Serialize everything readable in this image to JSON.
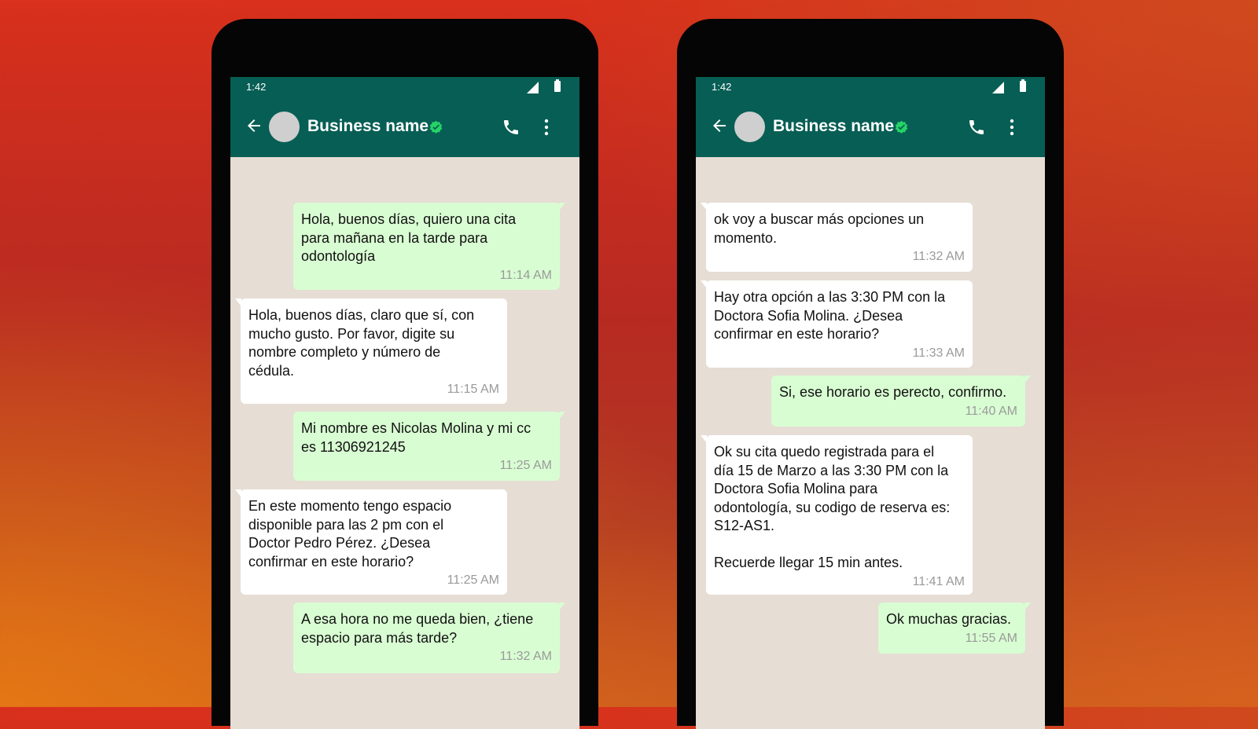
{
  "colors": {
    "header": "#075e54",
    "outgoing": "#d9fdd3",
    "incoming": "#ffffff",
    "chat_bg": "#e6ddd4",
    "verified": "#25d366"
  },
  "phones": [
    {
      "status_time": "1:42",
      "header": {
        "name": "Business name",
        "back_icon": "arrow-left-icon",
        "call_icon": "phone-icon",
        "menu_icon": "more-vert-icon",
        "verified_icon": "verified-badge-icon"
      },
      "messages": [
        {
          "dir": "out",
          "text": "Hola, buenos días, quiero una cita\npara mañana en la tarde para\nodontología",
          "time": "11:14 AM"
        },
        {
          "dir": "in",
          "text": "Hola, buenos días, claro que sí, con\nmucho gusto. Por favor, digite su\nnombre completo y número de\ncédula.",
          "time": "11:15 AM"
        },
        {
          "dir": "out",
          "text": "Mi nombre es Nicolas Molina y mi cc\nes 11306921245",
          "time": "11:25 AM"
        },
        {
          "dir": "in",
          "text": "En este momento tengo espacio\ndisponible para las 2 pm con el\nDoctor Pedro Pérez. ¿Desea\nconfirmar en este horario?",
          "time": "11:25 AM"
        },
        {
          "dir": "out",
          "text": "A esa hora no me queda bien, ¿tiene\nespacio para más tarde?",
          "time": "11:32 AM"
        }
      ]
    },
    {
      "status_time": "1:42",
      "header": {
        "name": "Business name",
        "back_icon": "arrow-left-icon",
        "call_icon": "phone-icon",
        "menu_icon": "more-vert-icon",
        "verified_icon": "verified-badge-icon"
      },
      "messages": [
        {
          "dir": "in",
          "text": "ok voy a buscar más opciones un\nmomento.",
          "time": "11:32 AM"
        },
        {
          "dir": "in",
          "text": "Hay otra opción a las 3:30 PM con la\nDoctora Sofia Molina.  ¿Desea\nconfirmar en este horario?",
          "time": "11:33 AM"
        },
        {
          "dir": "out",
          "text": "Si, ese horario es perecto, confirmo.",
          "time": "11:40 AM"
        },
        {
          "dir": "in",
          "text": "Ok su cita quedo registrada para el\ndía 15 de Marzo a las 3:30 PM con la\nDoctora Sofia Molina para\nodontología, su codigo de reserva es:\nS12-AS1.\n\nRecuerde llegar 15 min antes.",
          "time": "11:41 AM"
        },
        {
          "dir": "out",
          "text": "Ok muchas gracias.",
          "time": "11:55 AM"
        }
      ]
    }
  ]
}
